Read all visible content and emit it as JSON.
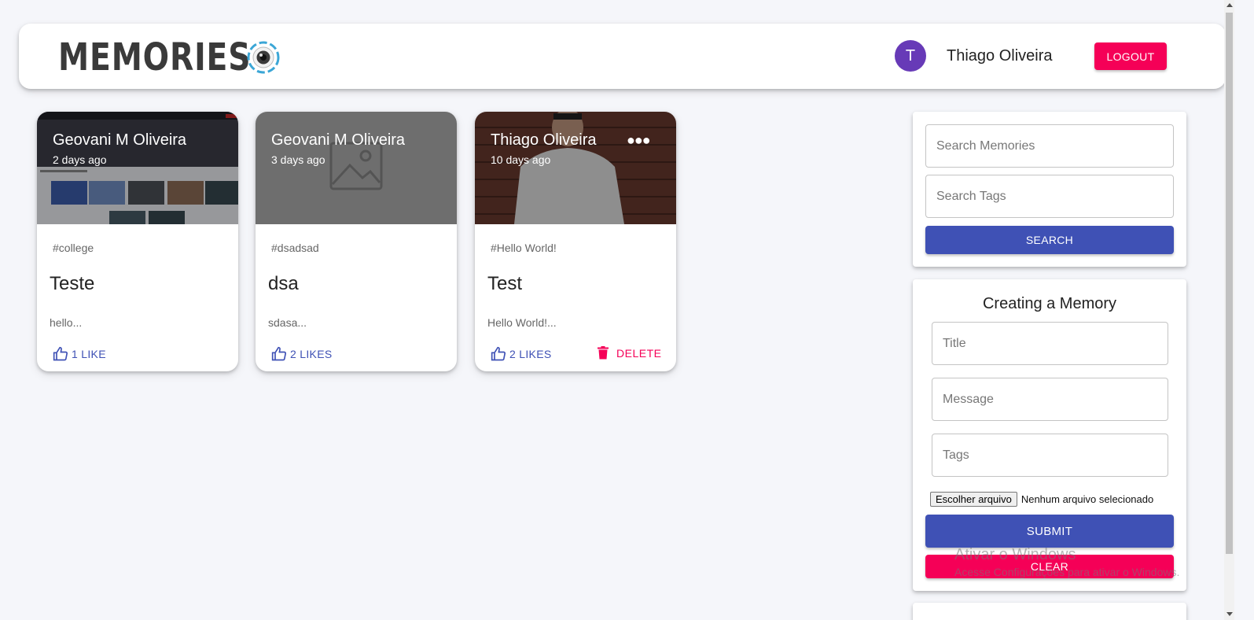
{
  "appbar": {
    "brand": "MEMORIES",
    "avatar_initial": "T",
    "user_name": "Thiago Oliveira",
    "logout_label": "LOGOUT"
  },
  "posts": [
    {
      "author": "Geovani M Oliveira",
      "time": "2 days ago",
      "tags": "#college",
      "title": "Teste",
      "message": "hello...",
      "likes": "1 LIKE",
      "image": "webpage-screenshot"
    },
    {
      "author": "Geovani M Oliveira",
      "time": "3 days ago",
      "tags": "#dsadsad",
      "title": "dsa",
      "message": "sdasa...",
      "likes": "2 LIKES",
      "image": "placeholder-image"
    },
    {
      "author": "Thiago Oliveira",
      "time": "10 days ago",
      "tags": "#Hello World!",
      "title": "Test",
      "message": "Hello World!...",
      "likes": "2 LIKES",
      "delete_label": "DELETE",
      "image": "person-photo"
    }
  ],
  "search": {
    "memories_placeholder": "Search Memories",
    "tags_placeholder": "Search Tags",
    "button_label": "SEARCH"
  },
  "form": {
    "heading": "Creating a Memory",
    "title_placeholder": "Title",
    "message_placeholder": "Message",
    "tags_placeholder": "Tags",
    "file_button": "Escolher arquivo",
    "file_status": "Nenhum arquivo selecionado",
    "submit_label": "SUBMIT",
    "clear_label": "CLEAR"
  },
  "watermark": {
    "line1": "Ativar o Windows",
    "line2": "Acesse Configurações para ativar o Windows."
  },
  "colors": {
    "primary": "#3f51b5",
    "secondary": "#f50057",
    "avatar": "#673ab7",
    "background": "#f5f6fa"
  }
}
